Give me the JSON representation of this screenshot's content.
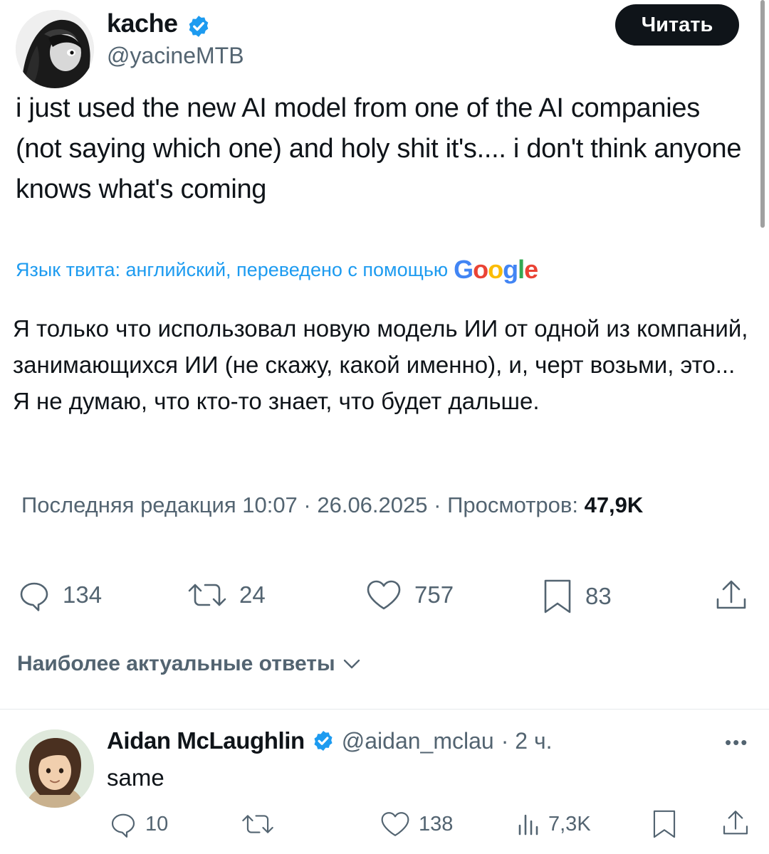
{
  "tweet": {
    "author_name": "kache",
    "author_handle": "@yacineMTB",
    "follow_label": "Читать",
    "text": "i just used the new AI model from one of the AI companies (not saying which one) and holy shit it's.... i don't think anyone knows what's coming",
    "translation_notice": "Язык твита: английский, переведено с помощью",
    "translation_provider": "Google",
    "translated_text": "Я только что использовал новую модель ИИ от одной из компаний, занимающихся ИИ (не скажу, какой именно), и, черт возьми, это... Я не думаю, что кто-то знает, что будет дальше.",
    "meta_prefix": "Последняя редакция 10:07 · 26.06.2025",
    "meta_views_label": " · Просмотров: ",
    "meta_views_value": "47,9K"
  },
  "actions": {
    "replies": "134",
    "retweets": "24",
    "likes": "757",
    "bookmarks": "83"
  },
  "replies_section": {
    "sort_label": "Наиболее актуальные ответы"
  },
  "reply": {
    "author_name": "Aidan McLaughlin",
    "author_handle": "@aidan_mclau",
    "time": "· 2 ч.",
    "text": "same",
    "replies": "10",
    "likes": "138",
    "views": "7,3K"
  },
  "colors": {
    "text_primary": "#0f1419",
    "text_secondary": "#536471",
    "link_blue": "#1d9bf0",
    "verified_blue": "#1d9bf0",
    "button_dark": "#0f1419"
  },
  "icons": [
    "verified-badge-icon",
    "reply-icon",
    "retweet-icon",
    "like-icon",
    "bookmark-icon",
    "share-icon",
    "views-icon",
    "chevron-down-icon",
    "more-icon"
  ]
}
